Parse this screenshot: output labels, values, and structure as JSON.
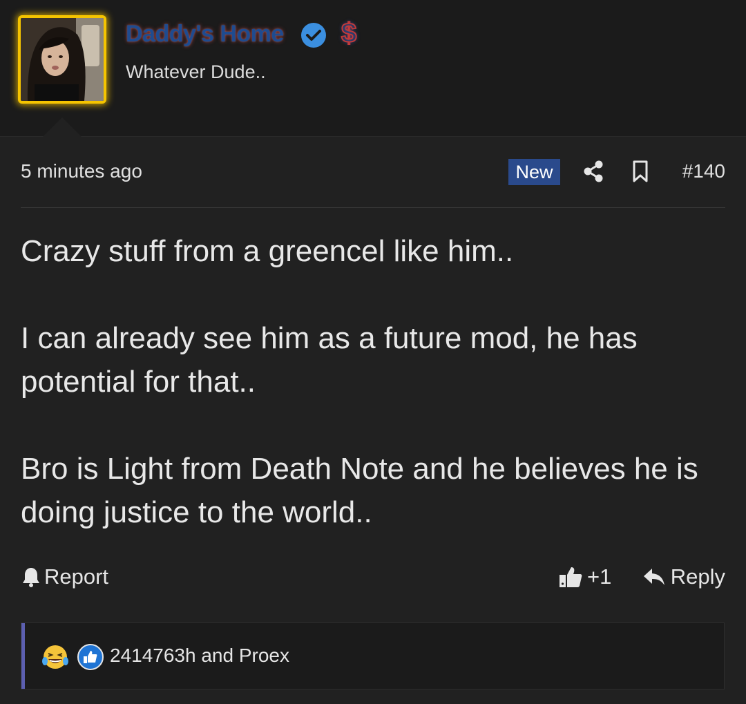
{
  "user": {
    "name": "Daddy's Home",
    "title": "Whatever Dude..",
    "dollar_symbol": "$",
    "avatar_border_color": "#f5c400"
  },
  "post": {
    "time": "5 minutes ago",
    "badge": "New",
    "number": "#140",
    "paragraphs": [
      "Crazy stuff from a greencel like him..",
      "I can already see him as a future mod, he has potential for that..",
      "Bro is Light from Death Note and he believes he is doing justice to the world.."
    ]
  },
  "actions": {
    "report_label": "Report",
    "like_label": "+1",
    "reply_label": "Reply"
  },
  "reactions": {
    "icons": [
      "laughing-crying-emoji-icon",
      "thumbs-up-reaction-icon"
    ],
    "text": "2414763h and Proex"
  },
  "colors": {
    "background": "#212121",
    "header_background": "#1b1b1b",
    "new_badge": "#2a4a8c",
    "reaction_bar": "#5c5fb0",
    "verified": "#3b8fe0"
  }
}
